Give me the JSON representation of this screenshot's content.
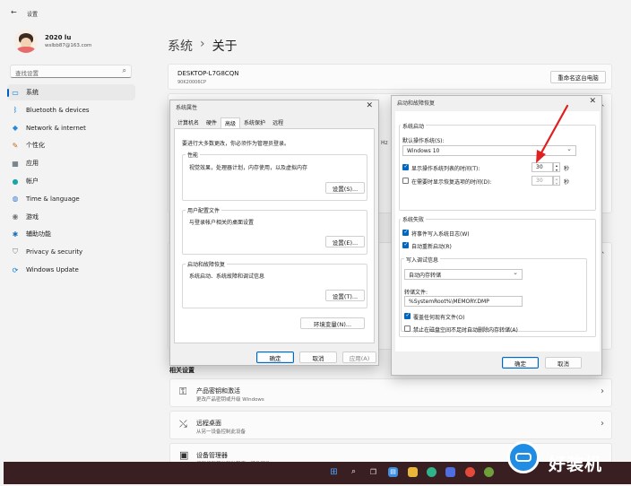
{
  "window": {
    "back_glyph": "←",
    "title": "设置"
  },
  "user": {
    "name": "2020 lu",
    "email": "wslbb87@163.com"
  },
  "search": {
    "placeholder": "查找设置"
  },
  "sidebar": {
    "items": [
      {
        "label": "系统",
        "icon": "monitor-icon",
        "glyph": "▭",
        "color": "#0078d4"
      },
      {
        "label": "Bluetooth & devices",
        "icon": "bluetooth-icon",
        "glyph": "ᛒ",
        "color": "#0078d4"
      },
      {
        "label": "Network & internet",
        "icon": "wifi-icon",
        "glyph": "◆",
        "color": "#2b88d8"
      },
      {
        "label": "个性化",
        "icon": "brush-icon",
        "glyph": "✎",
        "color": "#c46a1b"
      },
      {
        "label": "应用",
        "icon": "apps-icon",
        "glyph": "▦",
        "color": "#4a5a6a"
      },
      {
        "label": "帐户",
        "icon": "person-icon",
        "glyph": "●",
        "color": "#1fa3a3"
      },
      {
        "label": "Time & language",
        "icon": "globe-icon",
        "glyph": "◍",
        "color": "#3a7bd5"
      },
      {
        "label": "游戏",
        "icon": "gamepad-icon",
        "glyph": "◉",
        "color": "#777777"
      },
      {
        "label": "辅助功能",
        "icon": "accessibility-icon",
        "glyph": "✱",
        "color": "#1b6fb8"
      },
      {
        "label": "Privacy & security",
        "icon": "shield-icon",
        "glyph": "⛉",
        "color": "#777777"
      },
      {
        "label": "Windows Update",
        "icon": "update-icon",
        "glyph": "⟳",
        "color": "#0078d4"
      }
    ]
  },
  "header": {
    "section": "系统",
    "sep": "›",
    "page": "关于"
  },
  "device": {
    "name": "DESKTOP-L7G8CQN",
    "model": "90K20006CP",
    "rename_label": "重命名这台电脑",
    "hz_fragment": "Hz"
  },
  "related": {
    "title": "相关设置",
    "items": [
      {
        "title": "产品密钥和激活",
        "sub": "更改产品密钥或升级 Windows",
        "icon": "key-icon",
        "glyph": "⚿"
      },
      {
        "title": "远程桌面",
        "sub": "从另一设备控制此设备",
        "icon": "remote-icon",
        "glyph": "⤯"
      },
      {
        "title": "设备管理器",
        "sub": "",
        "icon": "device-manager-icon",
        "glyph": "▣"
      }
    ],
    "chevron": "›"
  },
  "sysprops": {
    "title": "系统属性",
    "close": "✕",
    "tabs": [
      "计算机名",
      "硬件",
      "高级",
      "系统保护",
      "远程"
    ],
    "active_tab": 2,
    "admin_note": "要进行大多数更改，你必须作为管理员登录。",
    "perf": {
      "label": "性能",
      "desc": "视觉效果，处理器计划，内存使用，以及虚拟内存",
      "button": "设置(S)..."
    },
    "profile": {
      "label": "用户配置文件",
      "desc": "与登录帐户相关的桌面设置",
      "button": "设置(E)..."
    },
    "startup": {
      "label": "启动和故障恢复",
      "desc": "系统启动、系统故障和调试信息",
      "button": "设置(T)..."
    },
    "env_button": "环境变量(N)...",
    "ok": "确定",
    "cancel": "取消",
    "apply": "应用(A)"
  },
  "recovery": {
    "title": "启动和故障恢复",
    "close": "✕",
    "startup_group": "系统启动",
    "default_os_label": "默认操作系统(S):",
    "default_os": "Windows 10",
    "show_list_label": "显示操作系统列表的时间(T):",
    "show_list_value": "30",
    "show_recovery_label": "在需要时显示恢复选项的时间(D):",
    "show_recovery_value": "30",
    "unit": "秒",
    "failure_group": "系统失败",
    "write_log": "将事件写入系统日志(W)",
    "auto_restart": "自动重新启动(R)",
    "debug_group": "写入调试信息",
    "debug_type": "自动内存转储",
    "dump_file_label": "转储文件:",
    "dump_file": "%SystemRoot%\\MEMORY.DMP",
    "overwrite": "覆盖任何现有文件(O)",
    "disable_low_disk": "禁止在磁盘空间不足时自动删除内存转储(A)",
    "ok": "确定",
    "cancel": "取消"
  },
  "watermark": {
    "text": "好装机"
  },
  "colors": {
    "accent": "#0067c0",
    "arrow": "#e02020",
    "taskbar": "#3a1f22"
  }
}
